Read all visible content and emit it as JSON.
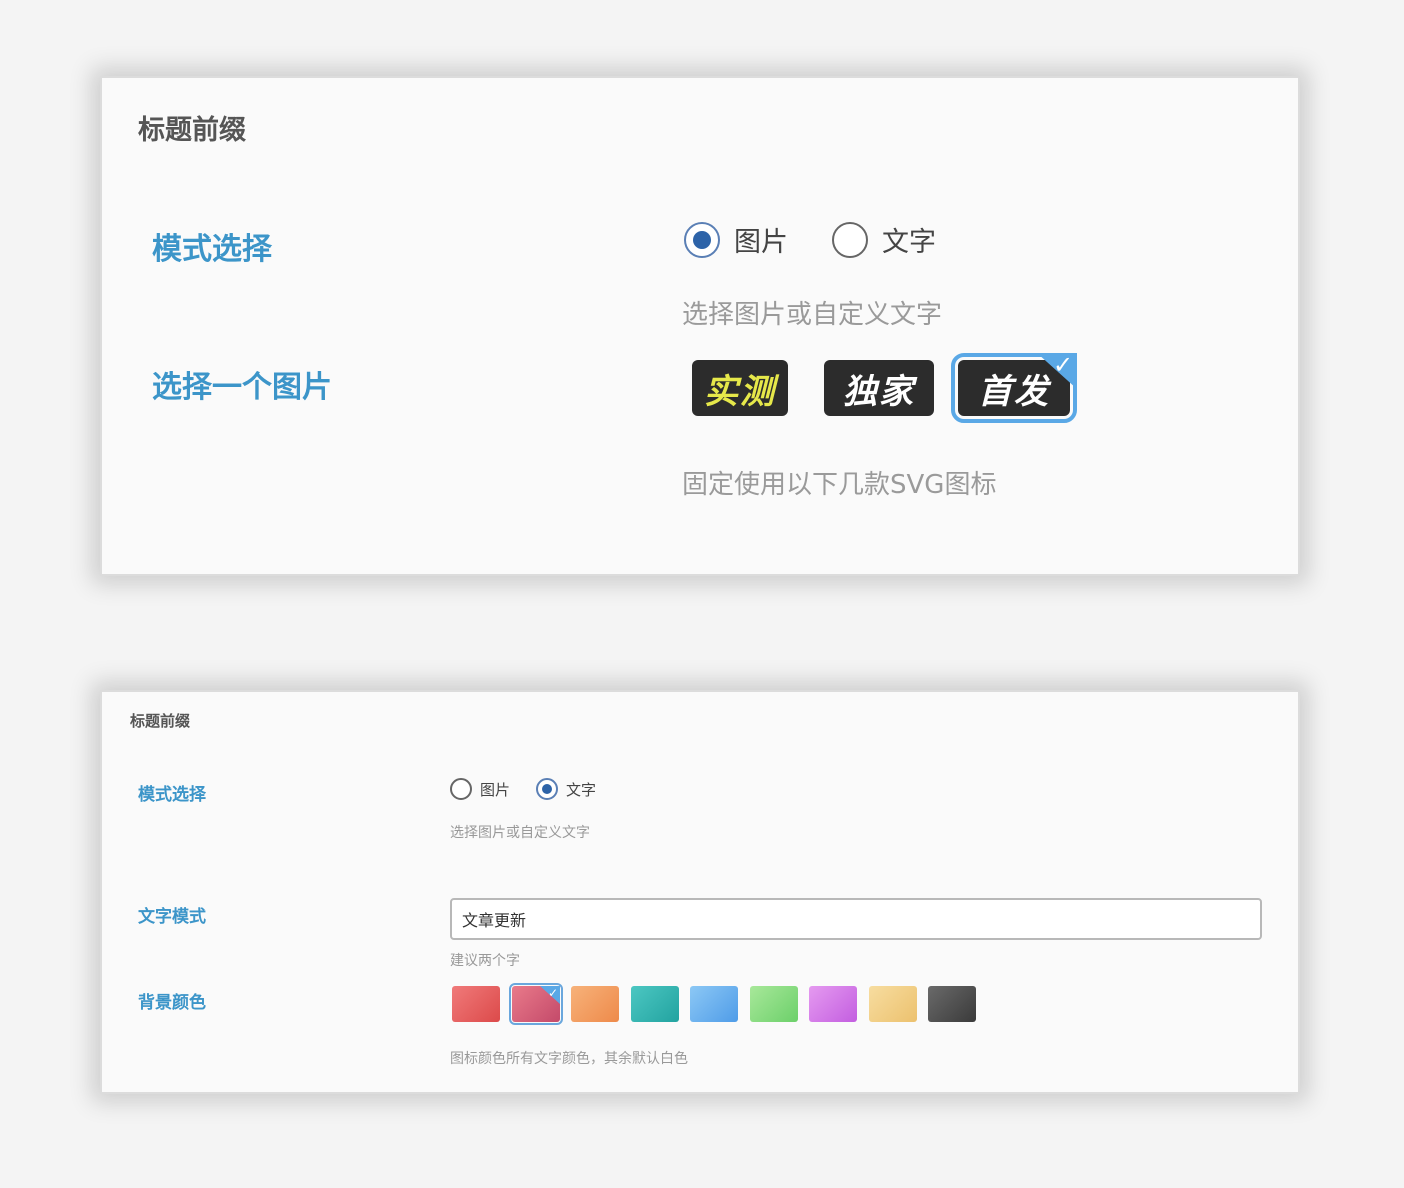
{
  "panel_image": {
    "title": "标题前缀",
    "mode_label": "模式选择",
    "mode_options": [
      {
        "label": "图片",
        "selected": true
      },
      {
        "label": "文字",
        "selected": false
      }
    ],
    "mode_hint": "选择图片或自定义文字",
    "image_label": "选择一个图片",
    "images": [
      {
        "text": "实测",
        "text_color": "#e6e84a",
        "selected": false
      },
      {
        "text": "独家",
        "text_color": "#ffffff",
        "selected": false
      },
      {
        "text": "首发",
        "text_color": "#ffffff",
        "selected": true
      }
    ],
    "image_hint": "固定使用以下几款SVG图标"
  },
  "panel_text": {
    "title": "标题前缀",
    "mode_label": "模式选择",
    "mode_options": [
      {
        "label": "图片",
        "selected": false
      },
      {
        "label": "文字",
        "selected": true
      }
    ],
    "mode_hint": "选择图片或自定义文字",
    "text_label": "文字模式",
    "text_value": "文章更新",
    "text_hint": "建议两个字",
    "color_label": "背景颜色",
    "colors": [
      {
        "from": "#f07a7a",
        "to": "#dc4a4a",
        "selected": false
      },
      {
        "from": "#e97a8a",
        "to": "#c44a6a",
        "selected": true
      },
      {
        "from": "#f7b27a",
        "to": "#ee8a4a",
        "selected": false
      },
      {
        "from": "#4cc7c2",
        "to": "#22a3a0",
        "selected": false
      },
      {
        "from": "#8cc8f5",
        "to": "#4f9ce8",
        "selected": false
      },
      {
        "from": "#a8e89a",
        "to": "#6cd06a",
        "selected": false
      },
      {
        "from": "#e59af0",
        "to": "#c35ee0",
        "selected": false
      },
      {
        "from": "#f7dda0",
        "to": "#ecc16e",
        "selected": false
      },
      {
        "from": "#6a6a6a",
        "to": "#3a3a3a",
        "selected": false
      }
    ],
    "color_hint": "图标颜色所有文字颜色，其余默认白色"
  }
}
